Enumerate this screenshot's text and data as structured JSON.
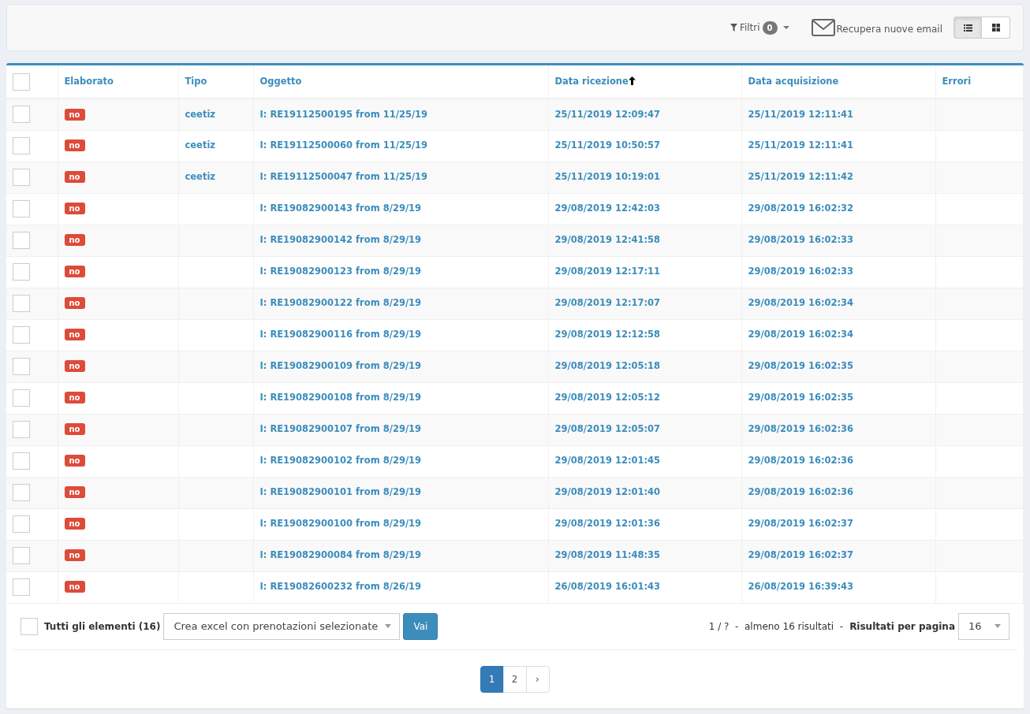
{
  "toolbar": {
    "filter": {
      "label": "Filtri",
      "count": "0"
    },
    "fetch_email": {
      "label": "Recupera nuove email"
    },
    "view_buttons": [
      {
        "kind": "list",
        "selected": true
      },
      {
        "kind": "grid",
        "selected": false
      }
    ]
  },
  "table": {
    "header_checkbox": {
      "checked": false
    },
    "columns": [
      {
        "label": "Elaborato",
        "sorted": false
      },
      {
        "label": "Tipo",
        "sorted": false
      },
      {
        "label": "Oggetto",
        "sorted": false
      },
      {
        "label": "Data ricezione",
        "sorted": true
      },
      {
        "label": "Data acquisizione",
        "sorted": false
      },
      {
        "label": "Errori",
        "sorted": false
      }
    ],
    "rows": [
      {
        "checked": false,
        "elaborato": "no",
        "tipo": "ceetiz",
        "oggetto": "I: RE19112500195 from 11/25/19",
        "data_ricezione": "25/11/2019 12:09:47",
        "data_acquisizione": "25/11/2019 12:11:41"
      },
      {
        "checked": false,
        "elaborato": "no",
        "tipo": "ceetiz",
        "oggetto": "I: RE19112500060 from 11/25/19",
        "data_ricezione": "25/11/2019 10:50:57",
        "data_acquisizione": "25/11/2019 12:11:41"
      },
      {
        "checked": false,
        "elaborato": "no",
        "tipo": "ceetiz",
        "oggetto": "I: RE19112500047 from 11/25/19",
        "data_ricezione": "25/11/2019 10:19:01",
        "data_acquisizione": "25/11/2019 12:11:42"
      },
      {
        "checked": false,
        "elaborato": "no",
        "oggetto": "I: RE19082900143 from 8/29/19",
        "data_ricezione": "29/08/2019 12:42:03",
        "data_acquisizione": "29/08/2019 16:02:32"
      },
      {
        "checked": false,
        "elaborato": "no",
        "oggetto": "I: RE19082900142 from 8/29/19",
        "data_ricezione": "29/08/2019 12:41:58",
        "data_acquisizione": "29/08/2019 16:02:33"
      },
      {
        "checked": false,
        "elaborato": "no",
        "oggetto": "I: RE19082900123 from 8/29/19",
        "data_ricezione": "29/08/2019 12:17:11",
        "data_acquisizione": "29/08/2019 16:02:33"
      },
      {
        "checked": false,
        "elaborato": "no",
        "oggetto": "I: RE19082900122 from 8/29/19",
        "data_ricezione": "29/08/2019 12:17:07",
        "data_acquisizione": "29/08/2019 16:02:34"
      },
      {
        "checked": false,
        "elaborato": "no",
        "oggetto": "I: RE19082900116 from 8/29/19",
        "data_ricezione": "29/08/2019 12:12:58",
        "data_acquisizione": "29/08/2019 16:02:34"
      },
      {
        "checked": false,
        "elaborato": "no",
        "oggetto": "I: RE19082900109 from 8/29/19",
        "data_ricezione": "29/08/2019 12:05:18",
        "data_acquisizione": "29/08/2019 16:02:35"
      },
      {
        "checked": false,
        "elaborato": "no",
        "oggetto": "I: RE19082900108 from 8/29/19",
        "data_ricezione": "29/08/2019 12:05:12",
        "data_acquisizione": "29/08/2019 16:02:35"
      },
      {
        "checked": false,
        "elaborato": "no",
        "oggetto": "I: RE19082900107 from 8/29/19",
        "data_ricezione": "29/08/2019 12:05:07",
        "data_acquisizione": "29/08/2019 16:02:36"
      },
      {
        "checked": false,
        "elaborato": "no",
        "oggetto": "I: RE19082900102 from 8/29/19",
        "data_ricezione": "29/08/2019 12:01:45",
        "data_acquisizione": "29/08/2019 16:02:36"
      },
      {
        "checked": false,
        "elaborato": "no",
        "oggetto": "I: RE19082900101 from 8/29/19",
        "data_ricezione": "29/08/2019 12:01:40",
        "data_acquisizione": "29/08/2019 16:02:36"
      },
      {
        "checked": false,
        "elaborato": "no",
        "oggetto": "I: RE19082900100 from 8/29/19",
        "data_ricezione": "29/08/2019 12:01:36",
        "data_acquisizione": "29/08/2019 16:02:37"
      },
      {
        "checked": false,
        "elaborato": "no",
        "oggetto": "I: RE19082900084 from 8/29/19",
        "data_ricezione": "29/08/2019 11:48:35",
        "data_acquisizione": "29/08/2019 16:02:37"
      },
      {
        "checked": false,
        "elaborato": "no",
        "oggetto": "I: RE19082600232 from 8/26/19",
        "data_ricezione": "26/08/2019 16:01:43",
        "data_acquisizione": "26/08/2019 16:39:43"
      }
    ]
  },
  "footer": {
    "select_all": {
      "checked": false,
      "label": "Tutti gli elementi (16)"
    },
    "action_select": {
      "value": "Crea excel con prenotazioni selezionate"
    },
    "go_button": "Vai",
    "result_info": "1 / ?  -  almeno 16 risultati  -",
    "per_page_label": "Risultati per pagina",
    "per_page_value": "16"
  },
  "pagination": [
    {
      "label": "1",
      "selected": true
    },
    {
      "label": "2",
      "selected": false
    },
    {
      "label": "›",
      "selected": false
    }
  ]
}
